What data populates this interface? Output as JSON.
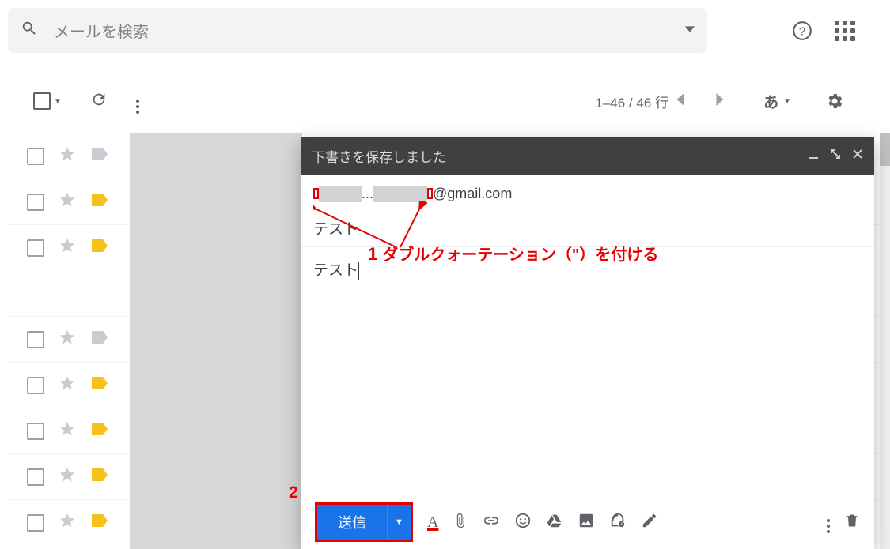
{
  "search": {
    "placeholder": "メールを検索"
  },
  "toolbar": {
    "pagination": "1–46 / 46 行",
    "lang": "あ"
  },
  "compose": {
    "header": "下書きを保存しました",
    "to_between": "...",
    "to_domain": "@gmail.com",
    "subject": "テスト",
    "body": "テスト",
    "send": "送信"
  },
  "annotations": {
    "n1": "1",
    "text1": "ダブルクォーテーション（\"）を付ける",
    "n2": "2"
  },
  "rows": [
    {
      "tag": "gray"
    },
    {
      "tag": "yellow"
    },
    {
      "tag": "yellow"
    },
    {
      "gap": true
    },
    {
      "tag": "gray"
    },
    {
      "tag": "yellow"
    },
    {
      "tag": "yellow"
    },
    {
      "tag": "yellow"
    },
    {
      "tag": "yellow"
    }
  ]
}
